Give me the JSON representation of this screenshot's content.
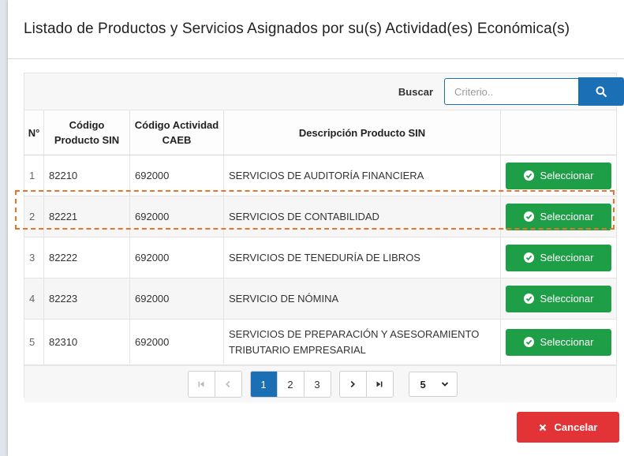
{
  "modal": {
    "title": "Listado de Productos y Servicios Asignados por su(s) Actividad(es) Económica(s)"
  },
  "search": {
    "label": "Buscar",
    "placeholder": "Criterio..",
    "value": ""
  },
  "table": {
    "headers": {
      "num": "N°",
      "codigo_line1": "Código",
      "codigo_line2": "Producto SIN",
      "caeb_line1": "Código Actividad",
      "caeb_line2": "CAEB",
      "descripcion": "Descripción Producto SIN"
    },
    "rows": [
      {
        "n": "1",
        "codigo": "82210",
        "caeb": "692000",
        "desc": "SERVICIOS DE AUDITORÍA FINANCIERA",
        "action": "Seleccionar"
      },
      {
        "n": "2",
        "codigo": "82221",
        "caeb": "692000",
        "desc": "SERVICIOS DE CONTABILIDAD",
        "action": "Seleccionar"
      },
      {
        "n": "3",
        "codigo": "82222",
        "caeb": "692000",
        "desc": "SERVICIOS DE TENEDURÍA DE LIBROS",
        "action": "Seleccionar"
      },
      {
        "n": "4",
        "codigo": "82223",
        "caeb": "692000",
        "desc": "SERVICIO DE NÓMINA",
        "action": "Seleccionar"
      },
      {
        "n": "5",
        "codigo": "82310",
        "caeb": "692000",
        "desc": "SERVICIOS DE PREPARACIÓN Y ASESORAMIENTO TRIBUTARIO EMPRESARIAL",
        "action": "Seleccionar"
      }
    ]
  },
  "pagination": {
    "pages": [
      "1",
      "2",
      "3"
    ],
    "current": "1",
    "page_size": "5"
  },
  "footer": {
    "cancel_label": "Cancelar"
  },
  "colors": {
    "primary": "#1b6fb5",
    "success": "#1f9e48",
    "danger": "#e23437",
    "highlight": "#e8742a"
  }
}
